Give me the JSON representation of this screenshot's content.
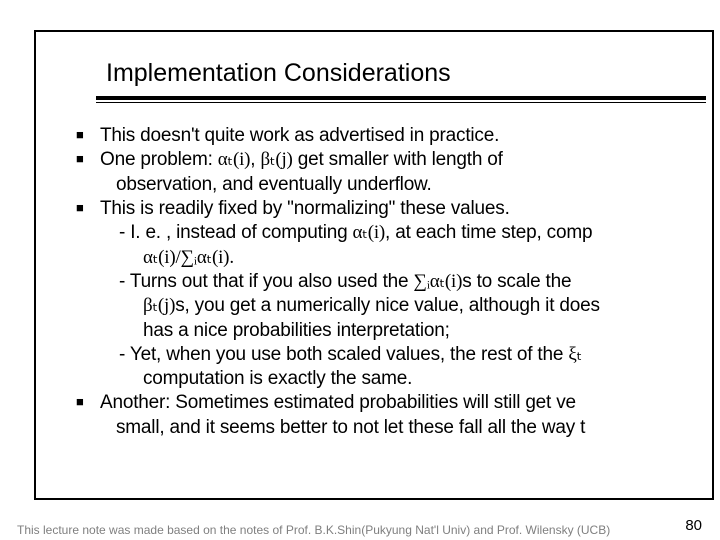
{
  "slide": {
    "title": "Implementation Considerations",
    "bullets": {
      "b1": "This doesn't quite work as advertised in practice.",
      "b2_a": "One problem: ",
      "alpha_ti": "αₜ(i)",
      "comma_sp": ", ",
      "beta_tj": "βₜ(j)",
      "b2_b": " get smaller with length of",
      "b2_c": "observation, and eventually underflow.",
      "b3": "This is readily fixed by \"normalizing\" these values.",
      "b3s1_a": "- I. e. , instead of computing ",
      "b3s1_b": ", at each time step, comp",
      "b3s1_c": "αₜ(i)/∑ᵢαₜ(i).",
      "b3s2_a": "- Turns out that if you also used the ",
      "sum_alpha": "∑ᵢαₜ(i)",
      "b3s2_b": "s to scale the",
      "b3s2_c1": "βₜ(j)",
      "b3s2_c2": "s, you get a numerically nice value, although it does",
      "b3s2_d": "has a nice probabilities interpretation;",
      "b3s3_a": "- Yet, when you use both scaled values, the rest of the ",
      "xi_t": "ξₜ",
      "b3s3_b": "computation is exactly the same.",
      "b4_a": "Another: Sometimes estimated probabilities will still get ve",
      "b4_b": "small, and it seems better to not let these fall all the way t"
    },
    "footer": "This lecture note was made based on the notes of Prof. B.K.Shin(Pukyung Nat'l Univ) and Prof. Wilensky (UCB)",
    "pagenum": "80"
  }
}
